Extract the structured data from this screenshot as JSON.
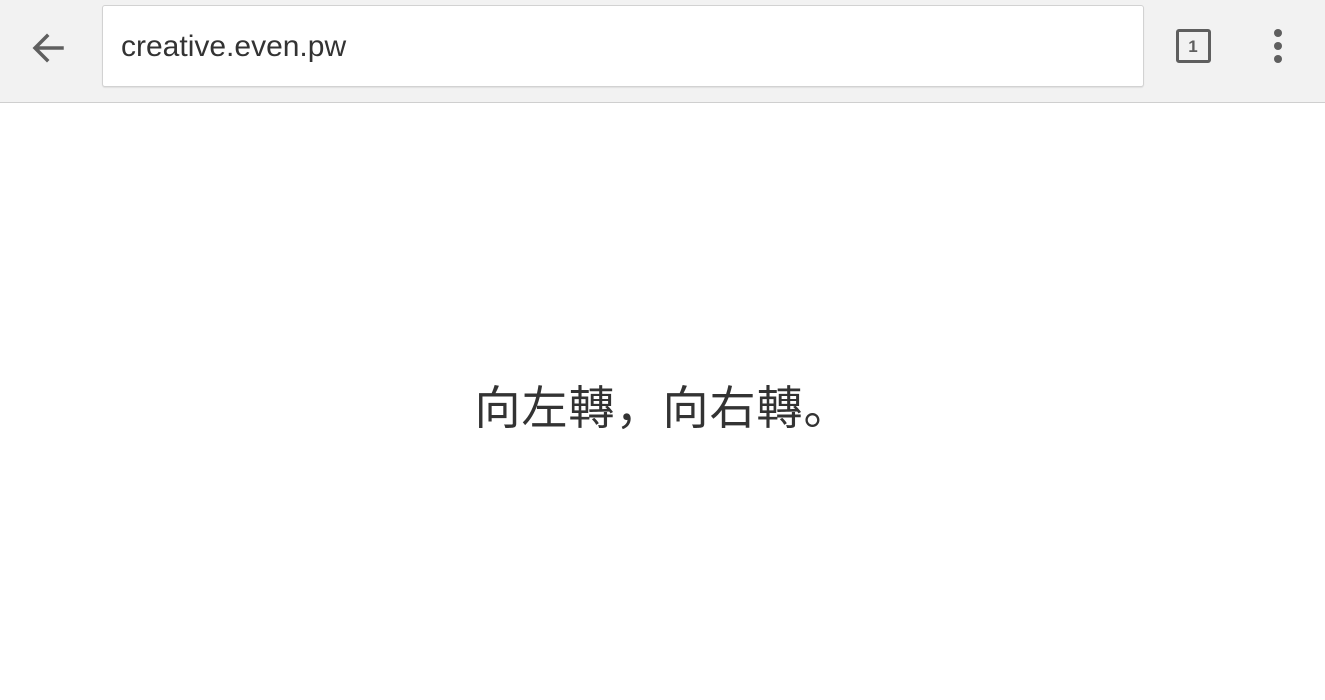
{
  "toolbar": {
    "back_icon": "arrow-left-icon",
    "url": "creative.even.pw",
    "tab_count": "1",
    "tab_icon": "tab-switcher-icon",
    "menu_icon": "more-vertical-icon"
  },
  "page": {
    "text": "向左轉，向右轉。"
  },
  "colors": {
    "toolbar_bg": "#f2f2f2",
    "icon": "#5f5f5f",
    "text": "#333333"
  }
}
